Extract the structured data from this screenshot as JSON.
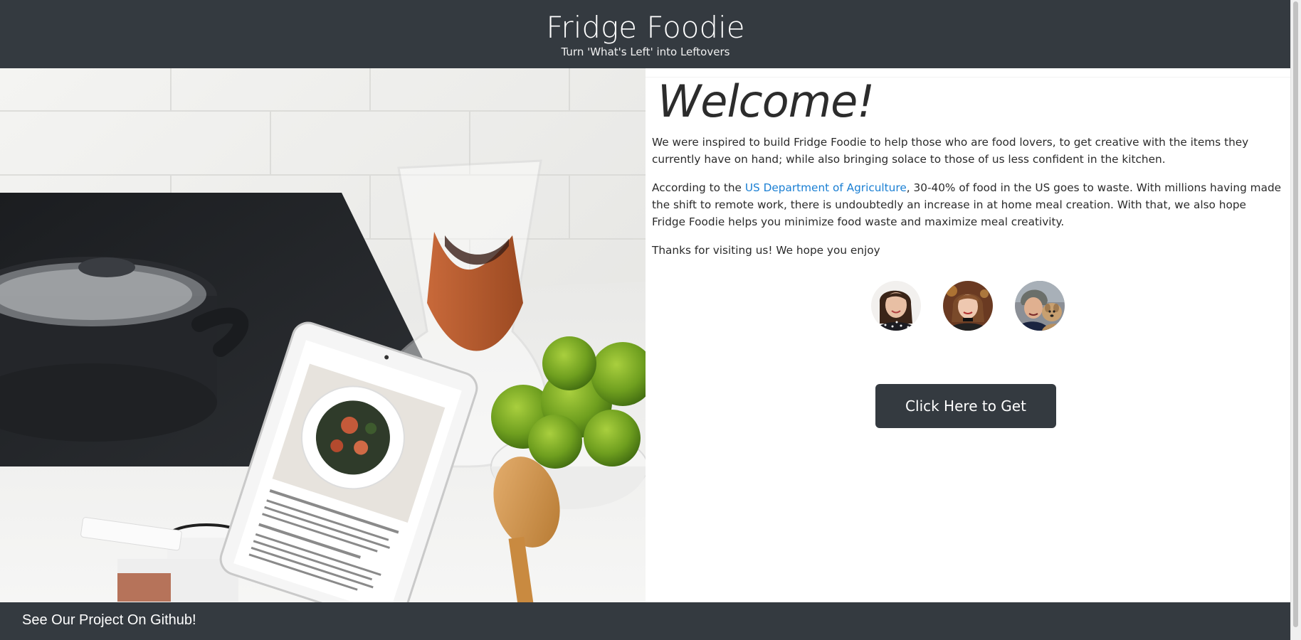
{
  "header": {
    "title": "Fridge Foodie",
    "subtitle": "Turn 'What's Left' into Leftovers"
  },
  "hero": {
    "image_description_icon": "kitchen-tablet-recipe-image"
  },
  "main": {
    "welcome": "Welcome!",
    "paragraph1": "We were inspired to build Fridge Foodie to help those who are food lovers, to get creative with the items they currently have on hand; while also bringing solace to those of us less confident in the kitchen.",
    "paragraph2_prefix": "According to the ",
    "paragraph2_link": "US Department of Agriculture",
    "paragraph2_suffix": ", 30-40% of food in the US goes to waste. With millions having made the shift to remote work, there is undoubtedly an increase in at home meal creation. With that, we also hope Fridge Foodie helps you minimize food waste and maximize meal creativity.",
    "paragraph3": "Thanks for visiting us! We hope you enjoy",
    "cta_label": "Click Here to Get Started!"
  },
  "footer": {
    "github_link": "See Our Project On Github!"
  },
  "colors": {
    "header_bg": "#343a40",
    "footer_bg": "#343a40",
    "button_bg": "#343a40",
    "link": "#1a7fd3",
    "text": "#2b2b2b"
  }
}
